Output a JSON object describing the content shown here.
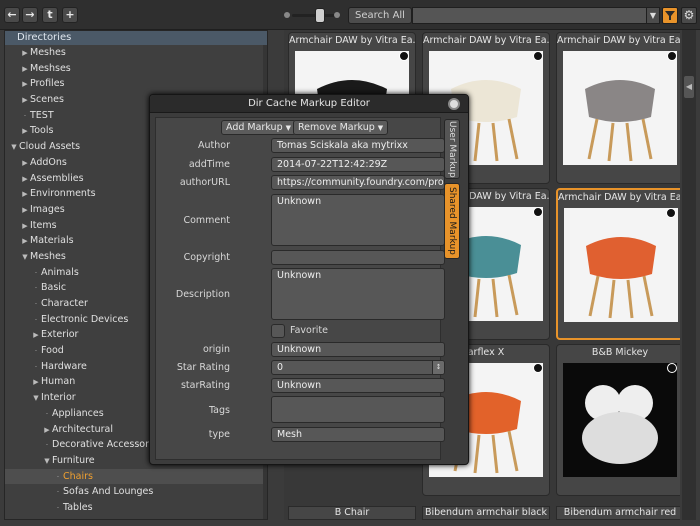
{
  "toolbar": {
    "back_icon": "arrow-left-icon",
    "forward_icon": "arrow-right-icon",
    "up_icon": "up-arrow-icon",
    "add_icon": "plus-icon",
    "search_label": "Search All",
    "search_value": "",
    "accent": "#e8932a"
  },
  "tree": {
    "header": "Directories",
    "items": [
      {
        "label": "Meshes",
        "depth": 1,
        "arrow": "▶"
      },
      {
        "label": "Meshses",
        "depth": 1,
        "arrow": "▶"
      },
      {
        "label": "Profiles",
        "depth": 1,
        "arrow": "▶"
      },
      {
        "label": "Scenes",
        "depth": 1,
        "arrow": "▶"
      },
      {
        "label": "TEST",
        "depth": 1,
        "arrow": "·"
      },
      {
        "label": "Tools",
        "depth": 1,
        "arrow": "▶"
      },
      {
        "label": "Cloud Assets",
        "depth": 0,
        "arrow": "▼"
      },
      {
        "label": "AddOns",
        "depth": 1,
        "arrow": "▶"
      },
      {
        "label": "Assemblies",
        "depth": 1,
        "arrow": "▶"
      },
      {
        "label": "Environments",
        "depth": 1,
        "arrow": "▶"
      },
      {
        "label": "Images",
        "depth": 1,
        "arrow": "▶"
      },
      {
        "label": "Items",
        "depth": 1,
        "arrow": "▶"
      },
      {
        "label": "Materials",
        "depth": 1,
        "arrow": "▶"
      },
      {
        "label": "Meshes",
        "depth": 1,
        "arrow": "▼"
      },
      {
        "label": "Animals",
        "depth": 2,
        "arrow": "·"
      },
      {
        "label": "Basic",
        "depth": 2,
        "arrow": "·"
      },
      {
        "label": "Character",
        "depth": 2,
        "arrow": "·"
      },
      {
        "label": "Electronic Devices",
        "depth": 2,
        "arrow": "·"
      },
      {
        "label": "Exterior",
        "depth": 2,
        "arrow": "▶"
      },
      {
        "label": "Food",
        "depth": 2,
        "arrow": "·"
      },
      {
        "label": "Hardware",
        "depth": 2,
        "arrow": "·"
      },
      {
        "label": "Human",
        "depth": 2,
        "arrow": "▶"
      },
      {
        "label": "Interior",
        "depth": 2,
        "arrow": "▼"
      },
      {
        "label": "Appliances",
        "depth": 3,
        "arrow": "·"
      },
      {
        "label": "Architectural",
        "depth": 3,
        "arrow": "▶"
      },
      {
        "label": "Decorative Accessories",
        "depth": 3,
        "arrow": "·"
      },
      {
        "label": "Furniture",
        "depth": 3,
        "arrow": "▼"
      },
      {
        "label": "Chairs",
        "depth": 4,
        "arrow": "·",
        "selected": true
      },
      {
        "label": "Sofas And Lounges",
        "depth": 4,
        "arrow": "·"
      },
      {
        "label": "Tables",
        "depth": 4,
        "arrow": "·"
      }
    ]
  },
  "grid": {
    "cells": [
      {
        "caption": "Armchair DAW by Vitra Ea...",
        "tone": "black"
      },
      {
        "caption": "Armchair DAW by Vitra Ea...",
        "tone": "cream"
      },
      {
        "caption": "Armchair DAW by Vitra Ea...",
        "tone": "grey"
      },
      {
        "caption": "",
        "tone": "hidden"
      },
      {
        "caption": "Armchair DAW by Vitra Ea...",
        "tone": "teal"
      },
      {
        "caption": "Armchair DAW by Vitra Ea...",
        "tone": "orange"
      },
      {
        "caption": "",
        "tone": "hidden"
      },
      {
        "caption": "arflex X",
        "tone": "orange-chair"
      },
      {
        "caption": "B&B Mickey",
        "tone": "mickey"
      }
    ],
    "bottom_captions": [
      "B Chair",
      "Bibendum armchair black",
      "Bibendum armchair red"
    ]
  },
  "dialog": {
    "title": "Dir Cache Markup Editor",
    "add_markup": "Add Markup",
    "remove_markup": "Remove Markup",
    "tabs": [
      "User Markup",
      "Shared Markup"
    ],
    "fields": {
      "author_label": "Author",
      "author": "Tomas Sciskala aka mytrixx",
      "addtime_label": "addTime",
      "addtime": "2014-07-22T12:42:29Z",
      "authorurl_label": "authorURL",
      "authorurl": "https://community.foundry.com/profile,",
      "comment_label": "Comment",
      "comment": "Unknown",
      "copyright_label": "Copyright",
      "copyright": "",
      "description_label": "Description",
      "description": "Unknown",
      "favorite_label": "Favorite",
      "origin_label": "origin",
      "origin": "Unknown",
      "star_rating_label": "Star Rating",
      "star_rating": "0",
      "starrating_label": "starRating",
      "starrating": "Unknown",
      "tags_label": "Tags",
      "tags": "",
      "type_label": "type",
      "type": "Mesh"
    }
  }
}
